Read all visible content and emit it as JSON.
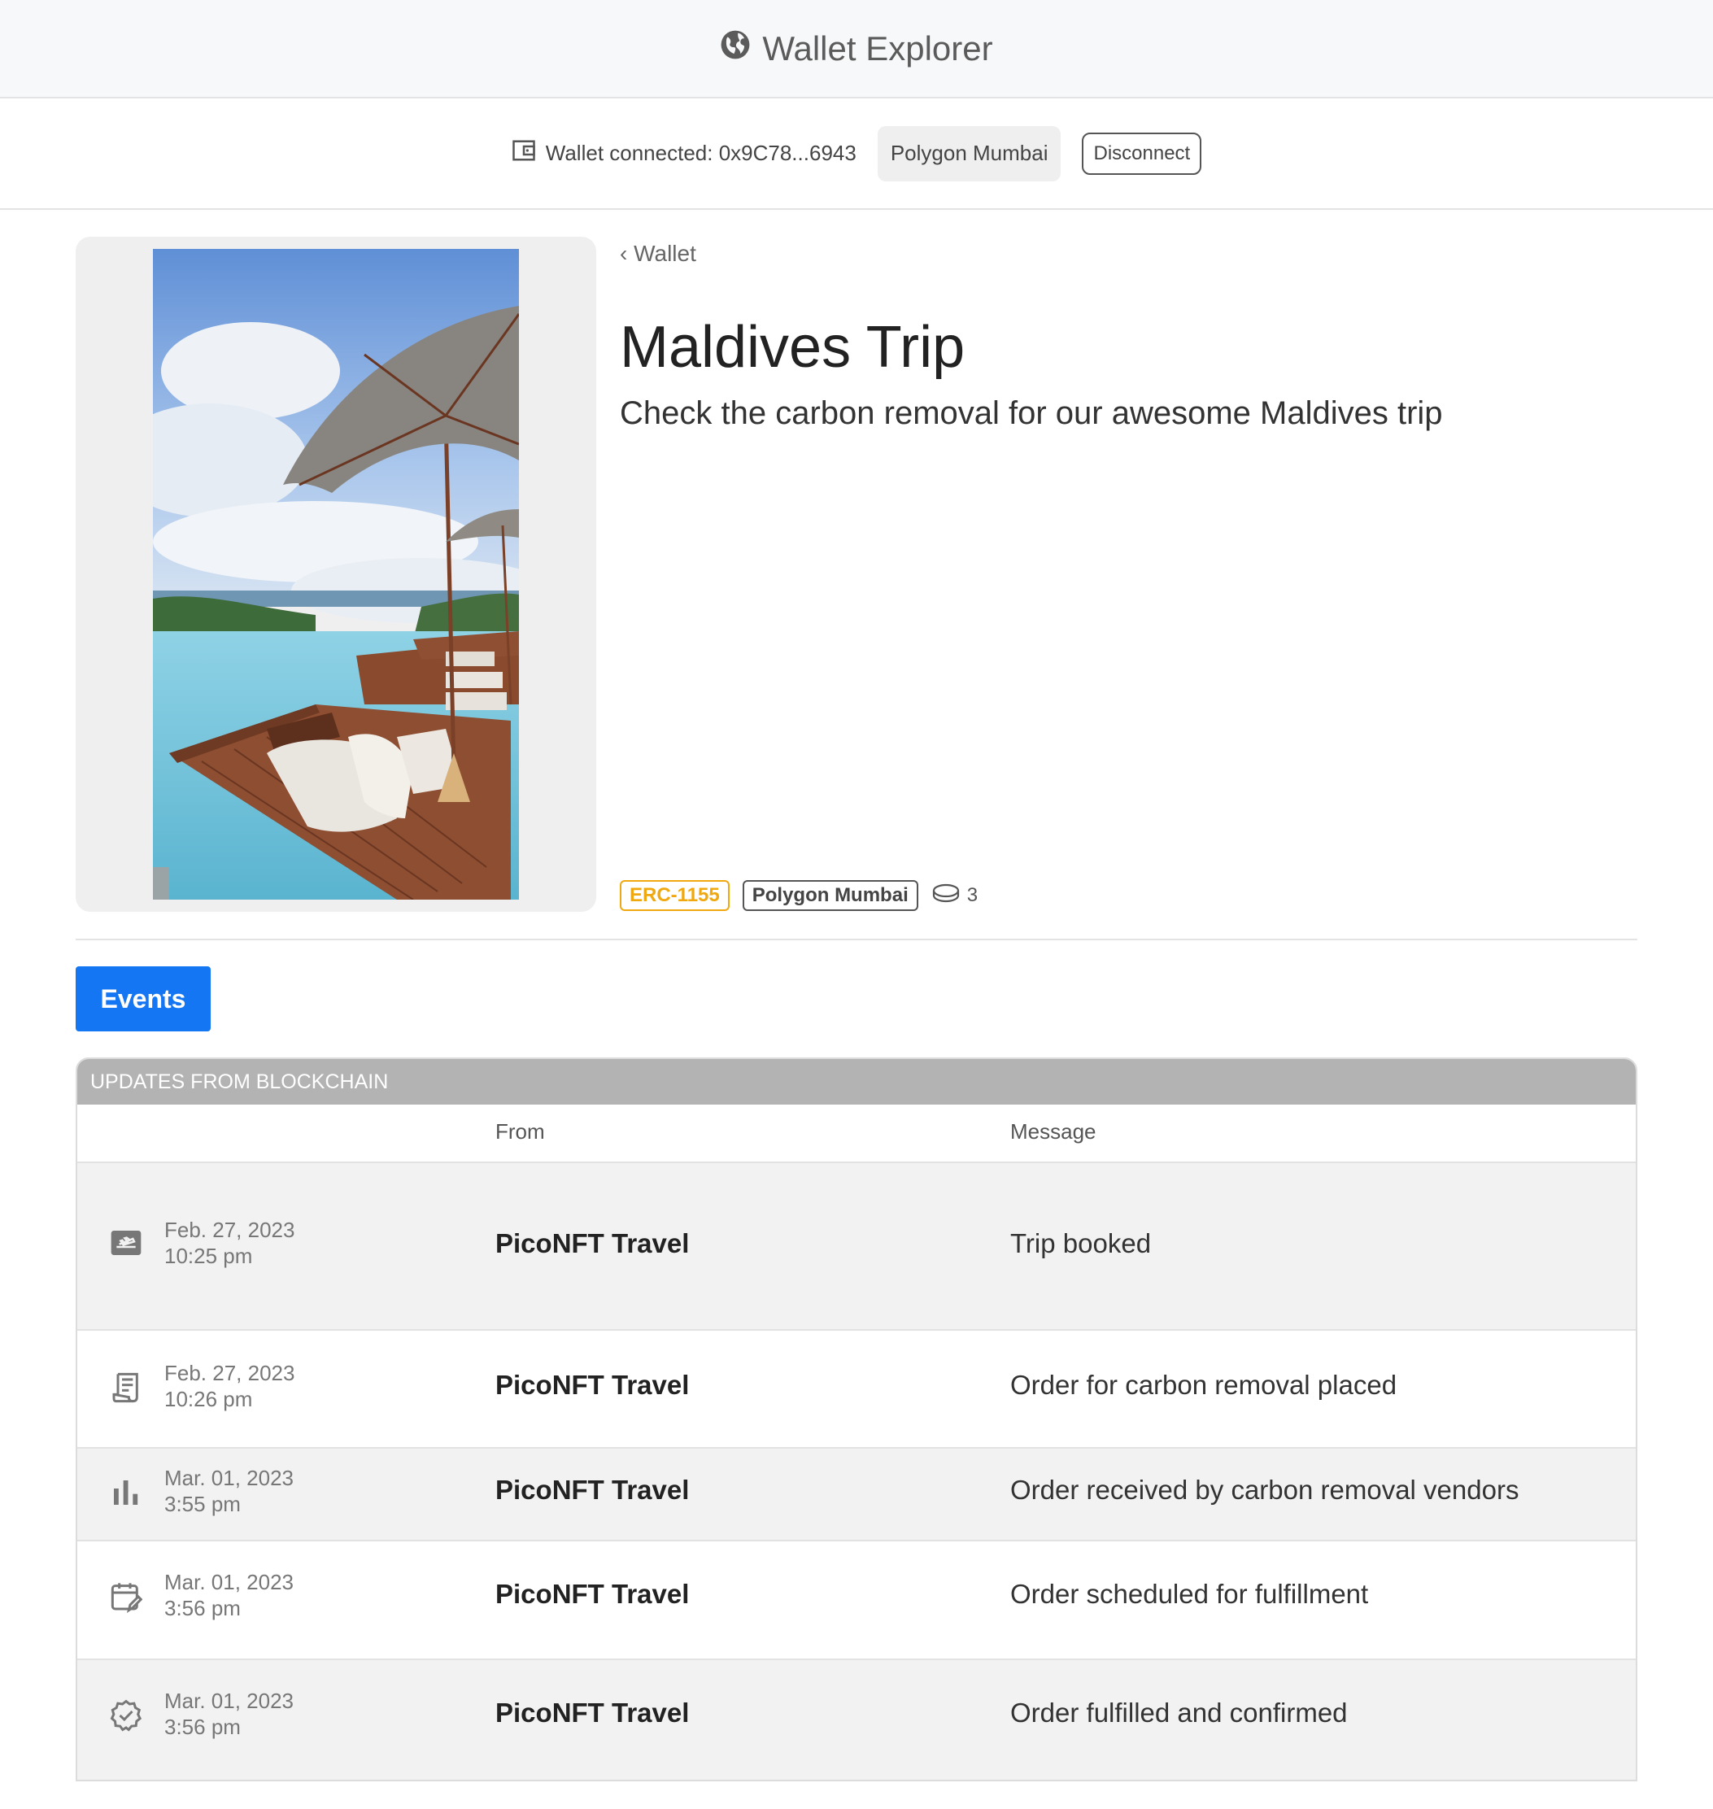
{
  "header": {
    "title": "Wallet Explorer",
    "icon": "globe-icon"
  },
  "wallet": {
    "status_text": "Wallet connected: 0x9C78...6943",
    "network": "Polygon Mumbai",
    "disconnect_label": "Disconnect"
  },
  "nft": {
    "back_label": "‹ Wallet",
    "title": "Maldives Trip",
    "description": "Check the carbon removal for our awesome Maldives trip",
    "standard": "ERC-1155",
    "network": "Polygon Mumbai",
    "supply": "3"
  },
  "tabs": {
    "events_label": "Events"
  },
  "events": {
    "section_title": "UPDATES FROM BLOCKCHAIN",
    "columns": {
      "from": "From",
      "message": "Message"
    },
    "rows": [
      {
        "icon": "flight-takeoff-icon",
        "date": "Feb. 27, 2023",
        "time": "10:25 pm",
        "from": "PicoNFT Travel",
        "message": "Trip booked"
      },
      {
        "icon": "receipt-icon",
        "date": "Feb. 27, 2023",
        "time": "10:26 pm",
        "from": "PicoNFT Travel",
        "message": "Order for carbon removal placed"
      },
      {
        "icon": "bar-chart-icon",
        "date": "Mar. 01, 2023",
        "time": "3:55 pm",
        "from": "PicoNFT Travel",
        "message": "Order received by carbon removal vendors"
      },
      {
        "icon": "calendar-edit-icon",
        "date": "Mar. 01, 2023",
        "time": "3:56 pm",
        "from": "PicoNFT Travel",
        "message": "Order scheduled for fulfillment"
      },
      {
        "icon": "verified-badge-icon",
        "date": "Mar. 01, 2023",
        "time": "3:56 pm",
        "from": "PicoNFT Travel",
        "message": "Order fulfilled and confirmed"
      }
    ]
  }
}
